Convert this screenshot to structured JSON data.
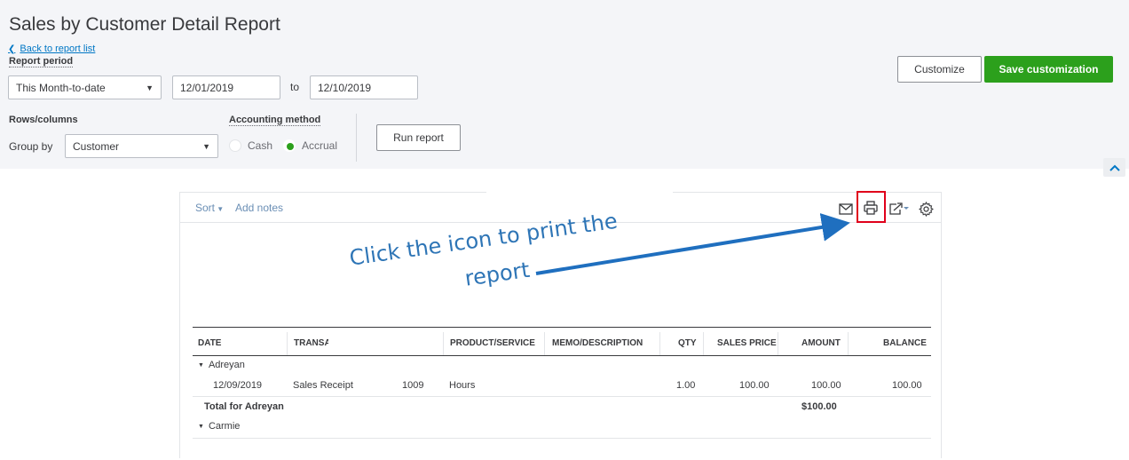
{
  "header": {
    "title": "Sales by Customer Detail Report",
    "back_link": "Back to report list",
    "report_period_label": "Report period",
    "period_select": "This Month-to-date",
    "date_from": "12/01/2019",
    "to_label": "to",
    "date_to": "12/10/2019",
    "rows_columns_label": "Rows/columns",
    "group_by_label": "Group by",
    "group_by_value": "Customer",
    "accounting_method_label": "Accounting method",
    "cash_label": "Cash",
    "accrual_label": "Accrual",
    "accrual_selected": true,
    "run_report": "Run report",
    "customize": "Customize",
    "save_customization": "Save customization"
  },
  "report": {
    "sort_label": "Sort",
    "add_notes_label": "Add notes",
    "toolbar_icons": [
      "email-icon",
      "print-icon",
      "export-icon",
      "gear-icon"
    ],
    "columns": [
      "DATE",
      "TRANSA",
      "PRODUCT/SERVICE",
      "MEMO/DESCRIPTION",
      "QTY",
      "SALES PRICE",
      "AMOUNT",
      "BALANCE"
    ],
    "groups": [
      {
        "name": "Adreyan",
        "rows": [
          {
            "date": "12/09/2019",
            "type": "Sales Receipt",
            "num": "1009",
            "product": "Hours",
            "memo": "",
            "qty": "1.00",
            "price": "100.00",
            "amount": "100.00",
            "balance": "100.00"
          }
        ],
        "total_label": "Total for Adreyan",
        "total_amount": "$100.00"
      },
      {
        "name": "Carmie",
        "rows": []
      }
    ]
  },
  "annotation": {
    "line1": "Click the icon to print the",
    "line2": "report",
    "color": "#2e75b6"
  },
  "colors": {
    "accent_green": "#2ca01c",
    "link_blue": "#0077c5",
    "highlight_red": "#e0001b"
  }
}
